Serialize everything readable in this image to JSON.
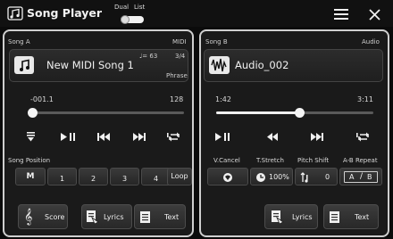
{
  "app": {
    "title": "Song Player",
    "mode_dual": "Dual",
    "mode_list": "List",
    "menu_icon": "hamburger-menu-icon",
    "close_icon": "close-icon"
  },
  "song_a": {
    "label": "Song A",
    "format": "MIDI",
    "song_name": "New MIDI Song 1",
    "tempo": "♩= 63",
    "time_signature": "3/4",
    "phrase_label": "Phrase",
    "position_time": "-001.1",
    "total": "128",
    "progress": 0.0,
    "controls": [
      "track-mute-icon",
      "play-pause-icon",
      "previous-icon",
      "next-icon",
      "repeat-icon"
    ],
    "song_position_label": "Song Position",
    "position_buttons": [
      "M",
      "1",
      "2",
      "3",
      "4",
      "Loop"
    ],
    "bottom_buttons": {
      "score": "Score",
      "lyrics": "Lyrics",
      "text": "Text"
    }
  },
  "song_b": {
    "label": "Song B",
    "format": "Audio",
    "song_name": "Audio_002",
    "position_time": "1:42",
    "total_time": "3:11",
    "progress": 0.53,
    "controls": [
      "play-pause-icon",
      "previous-icon",
      "next-icon",
      "repeat-icon"
    ],
    "v_cancel_label": "V.Cancel",
    "t_stretch_label": "T.Stretch",
    "t_stretch_value": "100%",
    "pitch_shift_label": "Pitch Shift",
    "pitch_shift_value": "0",
    "ab_repeat_label": "A-B Repeat",
    "ab_a": "A",
    "ab_b": "B",
    "bottom_buttons": {
      "lyrics": "Lyrics",
      "text": "Text"
    }
  },
  "colors": {
    "background": "#0b0b0b",
    "panel": "#1a1a1a",
    "border_selected": "#cfcfcf",
    "text": "#f0f0f0"
  }
}
